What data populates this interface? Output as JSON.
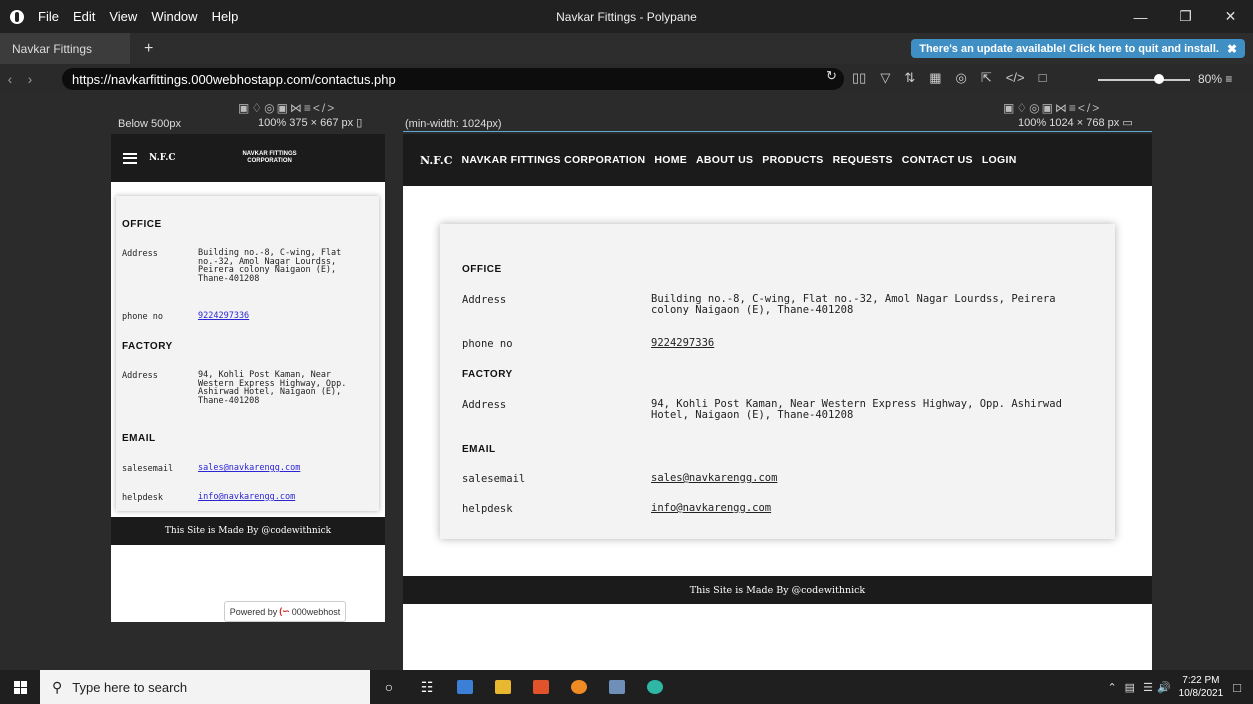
{
  "window": {
    "title": "Navkar Fittings - Polypane"
  },
  "menu": [
    "File",
    "Edit",
    "View",
    "Window",
    "Help"
  ],
  "tab": {
    "label": "Navkar Fittings",
    "add": "+"
  },
  "update_banner": "There's an update available! Click here to quit and install.",
  "address": {
    "url": "https://navkarfittings.000webhostapp.com/contactus.php"
  },
  "zoom": "80%",
  "panes": {
    "mobile": {
      "label": "Below 500px",
      "scale": "100%",
      "size": "375 × 667 px"
    },
    "desktop": {
      "label": "(min-width: 1024px)",
      "scale": "100%",
      "size": "1024 × 768 px"
    }
  },
  "site": {
    "brand": "N.F.C",
    "title": "NAVKAR FITTINGS CORPORATION",
    "nav": [
      "HOME",
      "ABOUT US",
      "PRODUCTS",
      "REQUESTS",
      "CONTACT US",
      "LOGIN"
    ],
    "office_heading": "OFFICE",
    "address_label": "Address",
    "office_address": "Building no.-8, C-wing, Flat no.-32, Amol Nagar Lourdss, Peirera colony Naigaon (E), Thane-401208",
    "phone_label": "phone no",
    "phone": "9224297336",
    "factory_heading": "FACTORY",
    "factory_address": "94, Kohli Post Kaman, Near Western Express Highway, Opp. Ashirwad Hotel, Naigaon (E), Thane-401208",
    "email_heading": "EMAIL",
    "salesemail_label": "salesemail",
    "salesemail": "sales@navkarengg.com",
    "helpdesk_label": "helpdesk",
    "helpdesk": "info@navkarengg.com",
    "footer": "This Site is Made By @codewithnick",
    "powered_by": "Powered by",
    "host": "000webhost"
  },
  "taskbar": {
    "search_placeholder": "Type here to search",
    "time": "7:22 PM",
    "date": "10/8/2021"
  }
}
